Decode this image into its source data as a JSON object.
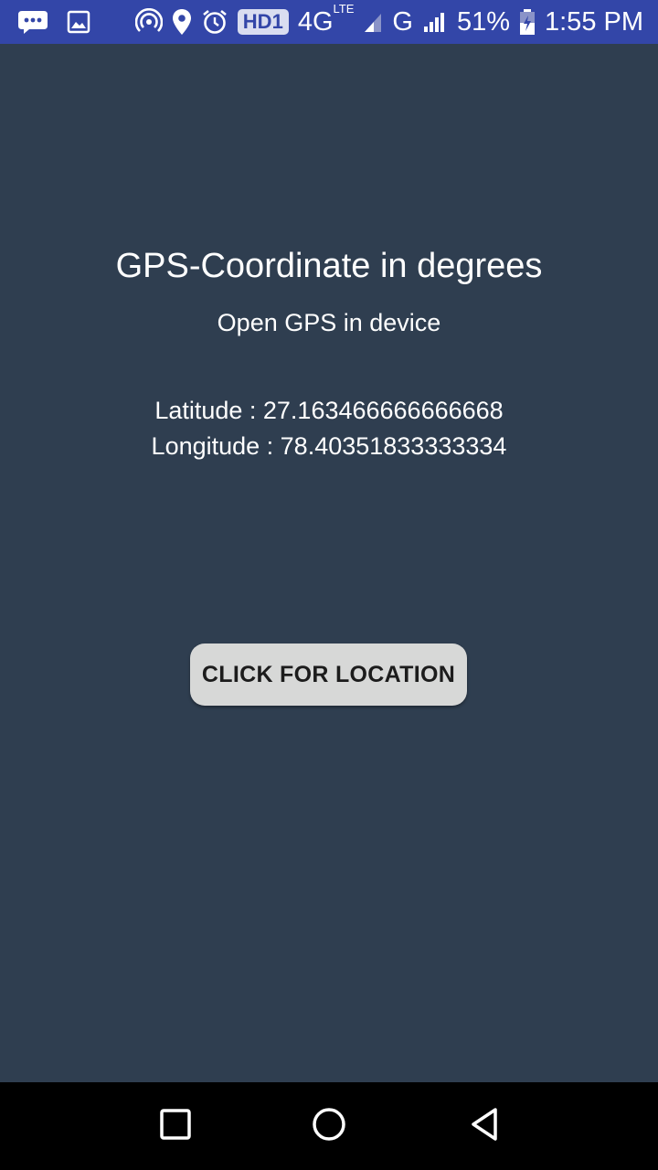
{
  "status_bar": {
    "icons": [
      "chat-bubble-icon",
      "image-icon",
      "hotspot-icon",
      "location-pin-icon",
      "alarm-clock-icon"
    ],
    "hd_label": "HD1",
    "network_4g": "4G",
    "network_lte": "LTE",
    "network_g": "G",
    "battery": "51%",
    "time": "1:55 PM",
    "color": "#3346a8"
  },
  "main": {
    "title": "GPS-Coordinate in degrees",
    "subtitle": "Open GPS in device",
    "latitude": "Latitude : 27.163466666666668",
    "longitude": "Longitude : 78.40351833333334",
    "button_label": "CLICK FOR LOCATION",
    "background_color": "#2f3e50",
    "button_color": "#d7d8d7"
  },
  "nav_bar": {
    "icons": [
      "recent-apps-icon",
      "home-icon",
      "back-icon"
    ]
  }
}
